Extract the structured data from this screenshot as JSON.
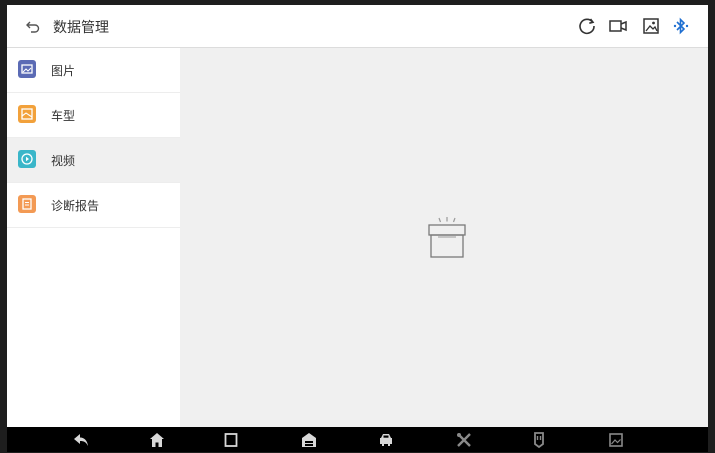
{
  "header": {
    "title": "数据管理",
    "icons": [
      "back-icon",
      "refresh-icon",
      "video-record-icon",
      "screenshot-icon",
      "bluetooth-icon"
    ]
  },
  "sidebar": {
    "items": [
      {
        "label": "图片",
        "icon": "image-icon",
        "color": "#5b6bb5"
      },
      {
        "label": "车型",
        "icon": "car-model-icon",
        "color": "#f2a13b"
      },
      {
        "label": "视频",
        "icon": "video-icon",
        "color": "#3ab6c9"
      },
      {
        "label": "诊断报告",
        "icon": "report-icon",
        "color": "#f39a54"
      }
    ],
    "selected_index": 2
  },
  "main": {
    "empty_icon": "empty-box-icon"
  },
  "navbar": {
    "icons": [
      "back-arrow-icon",
      "home-icon",
      "recent-apps-icon",
      "garage-icon",
      "car-icon",
      "tools-icon",
      "vci-icon",
      "gallery-icon"
    ]
  },
  "colors": {
    "accent_blue": "#1f6fd1",
    "background": "#f0f0f0"
  }
}
